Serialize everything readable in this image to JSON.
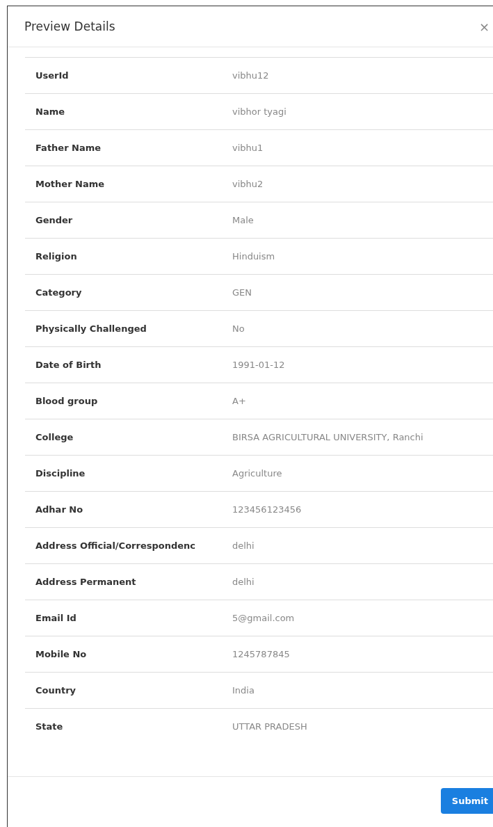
{
  "dialog": {
    "title": "Preview Details",
    "close": "×"
  },
  "rows": [
    {
      "label": "UserId",
      "value": "vibhu12"
    },
    {
      "label": "Name",
      "value": "vibhor tyagi"
    },
    {
      "label": "Father Name",
      "value": "vibhu1"
    },
    {
      "label": "Mother Name",
      "value": "vibhu2"
    },
    {
      "label": "Gender",
      "value": "Male"
    },
    {
      "label": "Religion",
      "value": "Hinduism"
    },
    {
      "label": "Category",
      "value": "GEN"
    },
    {
      "label": "Physically Challenged",
      "value": "No"
    },
    {
      "label": "Date of Birth",
      "value": "1991-01-12"
    },
    {
      "label": "Blood group",
      "value": "A+"
    },
    {
      "label": "College",
      "value": "BIRSA AGRICULTURAL UNIVERSITY, Ranchi"
    },
    {
      "label": "Discipline",
      "value": "Agriculture"
    },
    {
      "label": "Adhar No",
      "value": "123456123456"
    },
    {
      "label": "Address Official/Correspondenc",
      "value": "delhi"
    },
    {
      "label": "Address Permanent",
      "value": "delhi"
    },
    {
      "label": "Email Id",
      "value": "5@gmail.com"
    },
    {
      "label": "Mobile No",
      "value": "1245787845"
    },
    {
      "label": "Country",
      "value": "India"
    },
    {
      "label": "State",
      "value": "UTTAR PRADESH"
    }
  ],
  "footer": {
    "button": "Submit"
  }
}
